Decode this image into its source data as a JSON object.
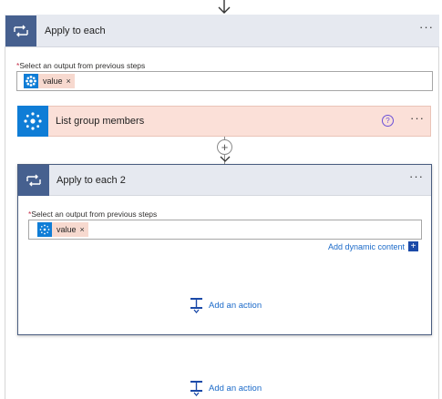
{
  "apply_outer": {
    "title": "Apply to each",
    "more": "···",
    "required_mark": "*",
    "field_label": "Select an output from previous steps",
    "token": {
      "label": "value",
      "remove": "×"
    },
    "add_action": "Add an action"
  },
  "list_group_members": {
    "title": "List group members",
    "help": "?",
    "more": "···"
  },
  "insert_step": {
    "symbol": "+"
  },
  "apply_inner": {
    "title": "Apply to each 2",
    "more": "···",
    "required_mark": "*",
    "field_label": "Select an output from previous steps",
    "token": {
      "label": "value",
      "remove": "×"
    },
    "dynamic_content": "Add dynamic content",
    "dynamic_plus": "+",
    "add_action": "Add an action"
  },
  "colors": {
    "loop_header": "#46608f",
    "header_band": "#e6e9f0",
    "connector_blue": "#0f7dd6",
    "token_bg": "#f7d9cf",
    "action_bg": "#fbe0d8",
    "link": "#1b6ac9"
  },
  "icons": [
    "arrow-down-icon",
    "loop-icon",
    "connector-icon",
    "help-icon",
    "more-icon",
    "add-action-icon",
    "close-icon"
  ]
}
